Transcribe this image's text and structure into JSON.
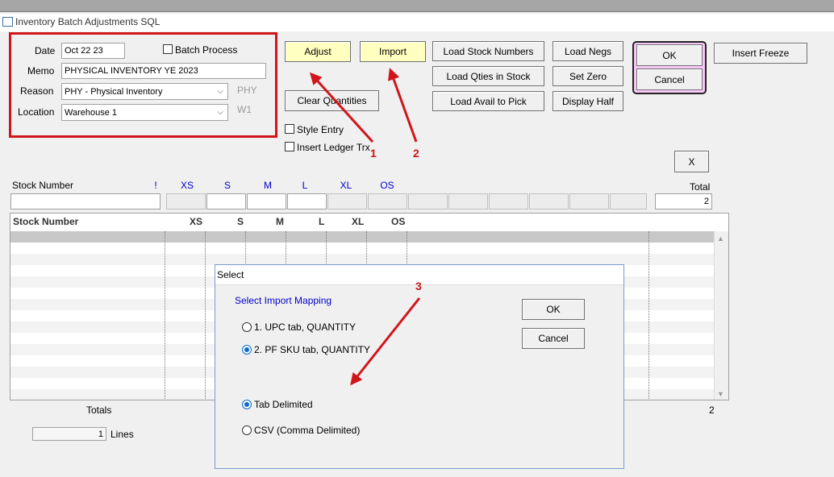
{
  "window": {
    "title": "Inventory Batch Adjustments SQL"
  },
  "header_form": {
    "date_label": "Date",
    "date_value": "Oct 22 23",
    "batch_process_label": "Batch Process",
    "memo_label": "Memo",
    "memo_value": "PHYSICAL INVENTORY YE 2023",
    "reason_label": "Reason",
    "reason_value": "PHY - Physical Inventory",
    "reason_code": "PHY",
    "location_label": "Location",
    "location_value": "Warehouse 1",
    "location_code": "W1"
  },
  "toolbar": {
    "adjust": "Adjust",
    "import": "Import",
    "load_stock_numbers": "Load Stock Numbers",
    "load_qties_in_stock": "Load Qties in Stock",
    "load_avail_to_pick": "Load Avail to Pick",
    "load_negs": "Load Negs",
    "set_zero": "Set Zero",
    "display_half": "Display Half",
    "ok": "OK",
    "cancel": "Cancel",
    "insert_freeze": "Insert Freeze",
    "clear_quantities": "Clear Quantities",
    "style_entry": "Style Entry",
    "insert_ledger_trx": "Insert Ledger Trx",
    "close_x": "X"
  },
  "entry_row": {
    "stock_number_label": "Stock Number",
    "bang": "!",
    "sizes": [
      "XS",
      "S",
      "M",
      "L",
      "XL",
      "OS"
    ],
    "total_label": "Total",
    "total_value": "2"
  },
  "grid": {
    "columns": [
      "Stock Number",
      "XS",
      "S",
      "M",
      "L",
      "XL",
      "OS"
    ],
    "totals_label": "Totals",
    "totals_value": "2",
    "lines_value": "1",
    "lines_label": "Lines"
  },
  "dialog": {
    "title": "Select",
    "heading": "Select Import Mapping",
    "mapping_options": [
      "1. UPC tab, QUANTITY",
      "2. PF SKU tab, QUANTITY"
    ],
    "format_options": [
      "Tab Delimited",
      "CSV (Comma Delimited)"
    ],
    "ok": "OK",
    "cancel": "Cancel"
  },
  "annotations": {
    "one": "1",
    "two": "2",
    "three": "3"
  },
  "colors": {
    "highlight_red": "#d0161b",
    "yellow_button": "#ffffc0",
    "pink_frame": "#f8c8f8",
    "link_blue": "#0000cc"
  }
}
